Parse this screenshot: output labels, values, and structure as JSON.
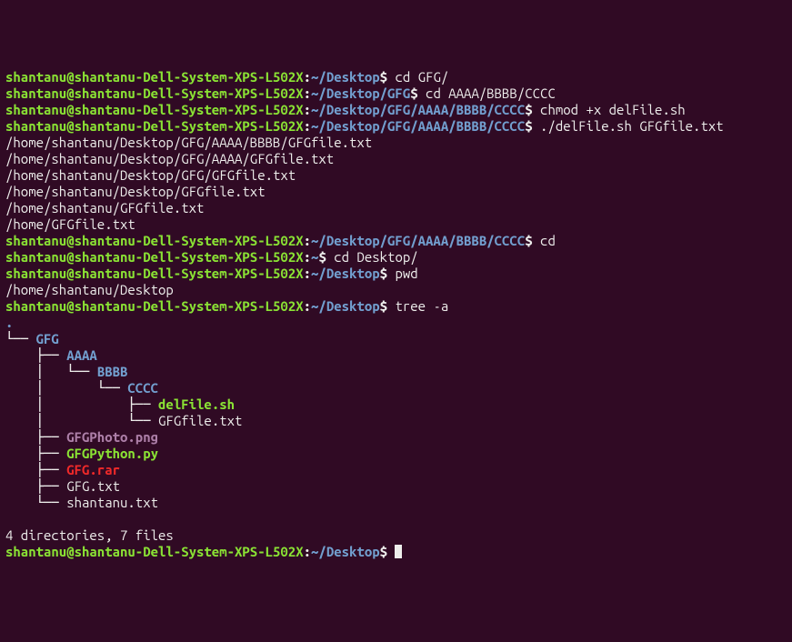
{
  "prompts": [
    {
      "user": "shantanu",
      "host": "shantanu-Dell-System-XPS-L502X",
      "path": "~/Desktop",
      "cmd": "cd GFG/"
    },
    {
      "user": "shantanu",
      "host": "shantanu-Dell-System-XPS-L502X",
      "path": "~/Desktop/GFG",
      "cmd": "cd AAAA/BBBB/CCCC"
    },
    {
      "user": "shantanu",
      "host": "shantanu-Dell-System-XPS-L502X",
      "path": "~/Desktop/GFG/AAAA/BBBB/CCCC",
      "cmd": "chmod +x delFile.sh"
    },
    {
      "user": "shantanu",
      "host": "shantanu-Dell-System-XPS-L502X",
      "path": "~/Desktop/GFG/AAAA/BBBB/CCCC",
      "cmd": "./delFile.sh GFGfile.txt"
    }
  ],
  "out1": [
    "/home/shantanu/Desktop/GFG/AAAA/BBBB/GFGfile.txt",
    "/home/shantanu/Desktop/GFG/AAAA/GFGfile.txt",
    "/home/shantanu/Desktop/GFG/GFGfile.txt",
    "/home/shantanu/Desktop/GFGfile.txt",
    "/home/shantanu/GFGfile.txt",
    "/home/GFGfile.txt"
  ],
  "prompts2": [
    {
      "user": "shantanu",
      "host": "shantanu-Dell-System-XPS-L502X",
      "path": "~/Desktop/GFG/AAAA/BBBB/CCCC",
      "cmd": "cd"
    },
    {
      "user": "shantanu",
      "host": "shantanu-Dell-System-XPS-L502X",
      "path": "~",
      "cmd": "cd Desktop/"
    },
    {
      "user": "shantanu",
      "host": "shantanu-Dell-System-XPS-L502X",
      "path": "~/Desktop",
      "cmd": "pwd"
    }
  ],
  "pwdOut": "/home/shantanu/Desktop",
  "prompts3": [
    {
      "user": "shantanu",
      "host": "shantanu-Dell-System-XPS-L502X",
      "path": "~/Desktop",
      "cmd": "tree -a"
    }
  ],
  "tree": {
    "root": ".",
    "l1": {
      "pre": "└── ",
      "name": "GFG"
    },
    "l2a": {
      "pre": "    ├── ",
      "name": "AAAA"
    },
    "l3": {
      "pre": "    │   └── ",
      "name": "BBBB"
    },
    "l4": {
      "pre": "    │       └── ",
      "name": "CCCC"
    },
    "l5a": {
      "pre": "    │           ├── ",
      "name": "delFile.sh"
    },
    "l5b": {
      "pre": "    │           └── ",
      "name": "GFGfile.txt"
    },
    "l2b": {
      "pre": "    ├── ",
      "name": "GFGPhoto.png"
    },
    "l2c": {
      "pre": "    ├── ",
      "name": "GFGPython.py"
    },
    "l2d": {
      "pre": "    ├── ",
      "name": "GFG.rar"
    },
    "l2e": {
      "pre": "    ├── ",
      "name": "GFG.txt"
    },
    "l2f": {
      "pre": "    └── ",
      "name": "shantanu.txt"
    }
  },
  "summary": "4 directories, 7 files",
  "finalPrompt": {
    "user": "shantanu",
    "host": "shantanu-Dell-System-XPS-L502X",
    "path": "~/Desktop",
    "cmd": ""
  },
  "sep": "@",
  "colon": ":",
  "dollar": "$ "
}
